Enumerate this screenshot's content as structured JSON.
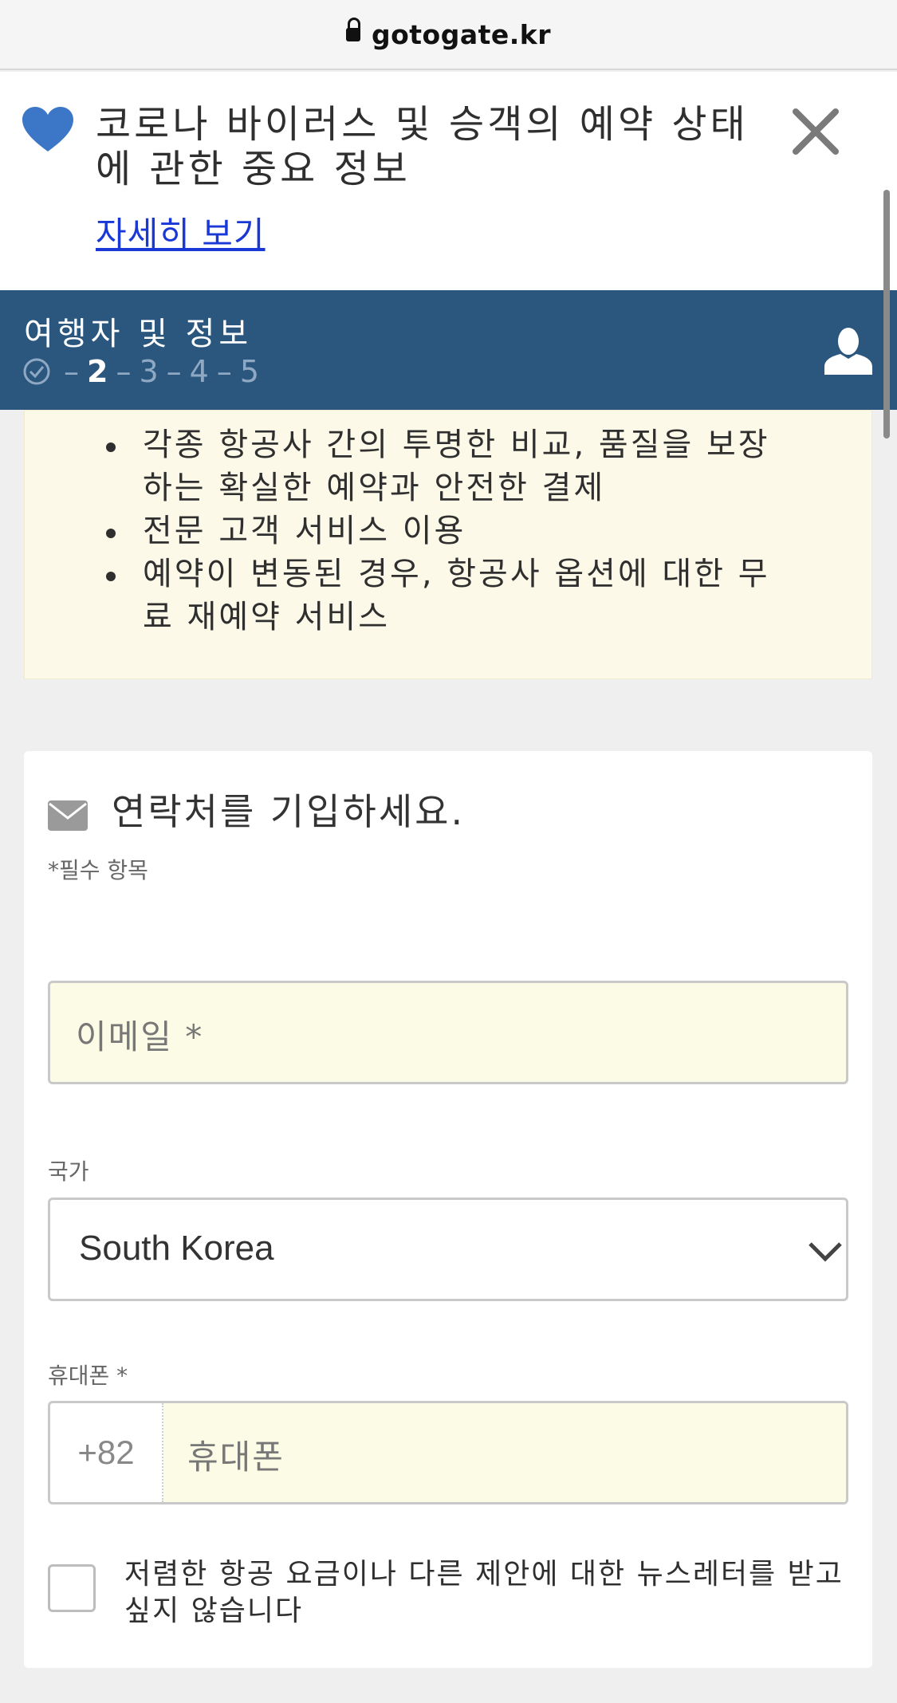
{
  "browser": {
    "url": "gotogate.kr"
  },
  "notice": {
    "title": "코로나 바이러스 및 승객의 예약 상태에 관한 중요 정보",
    "link": "자세히 보기",
    "icon": "heart-icon",
    "close_icon": "close-icon",
    "accent": "#3c76c6"
  },
  "progress": {
    "title": "여행자 및 정보",
    "steps": [
      "2",
      "3",
      "4",
      "5"
    ],
    "current_step": "2",
    "background": "#2b577f"
  },
  "benefits": {
    "items": [
      "각종 항공사 간의 투명한 비교, 품질을 보장하는 확실한 예약과 안전한 결제",
      "전문 고객 서비스 이용",
      "예약이 변동된 경우, 항공사 옵션에 대한 무료 재예약 서비스"
    ]
  },
  "contact": {
    "title": "연락처를 기입하세요.",
    "required_note": "*필수 항목",
    "email_placeholder": "이메일 *",
    "country_label": "국가",
    "country_value": "South Korea",
    "phone_label": "휴대폰 *",
    "phone_code": "+82",
    "phone_placeholder": "휴대폰",
    "newsletter_label": "저렴한 항공 요금이나 다른 제안에 대한 뉴스레터를 받고 싶지 않습니다"
  }
}
